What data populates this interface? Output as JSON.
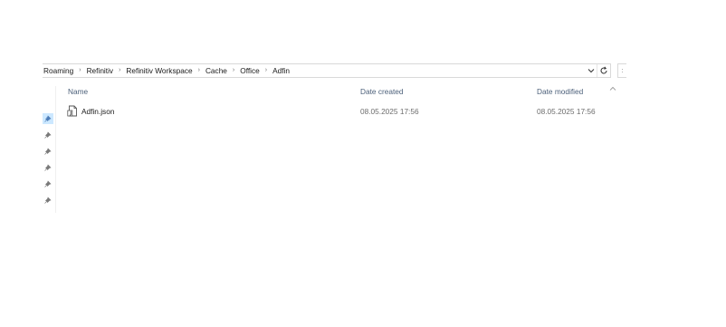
{
  "address_bar": {
    "breadcrumbs": [
      "Roaming",
      "Refinitiv",
      "Refinitiv Workspace",
      "Cache",
      "Office",
      "Adfin"
    ],
    "dropdown_icon": "chevron-down-icon",
    "refresh_icon": "refresh-icon"
  },
  "search": {
    "partial_text": ":"
  },
  "columns": {
    "name": "Name",
    "date_created": "Date created",
    "date_modified": "Date modified"
  },
  "files": [
    {
      "name": "Adfin.json",
      "date_created": "08.05.2025 17:56",
      "date_modified": "08.05.2025 17:56",
      "icon": "json-file-icon"
    }
  ],
  "nav_pins": {
    "count": 6,
    "icon": "pin-icon"
  },
  "colors": {
    "header_text": "#4c607a",
    "date_text": "#6d6d6d",
    "pin_selected": "#cce8ff",
    "border": "#d9d9d9"
  }
}
